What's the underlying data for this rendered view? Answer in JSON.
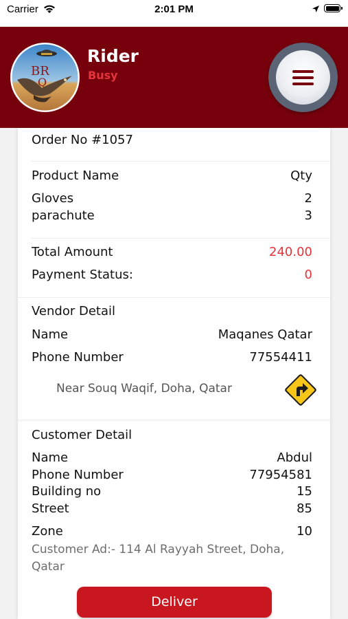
{
  "status_bar": {
    "carrier": "Carrier",
    "time": "2:01 PM"
  },
  "header": {
    "rider_title": "Rider",
    "rider_status": "Busy",
    "logo_text": "BRQ",
    "bg_color": "#77000d",
    "status_color": "#e5343a"
  },
  "order": {
    "number_label": "Order No #1057",
    "product_header": "Product Name",
    "qty_header": "Qty",
    "items": [
      {
        "name": "Gloves",
        "qty": "2"
      },
      {
        "name": "parachute",
        "qty": "3"
      }
    ],
    "total_label": "Total Amount",
    "total_value": "240.00",
    "payment_label": "Payment Status:",
    "payment_value": "0"
  },
  "vendor": {
    "section_title": "Vendor Detail",
    "name_label": "Name",
    "name_value": "Maqanes Qatar",
    "phone_label": "Phone Number",
    "phone_value": "77554411",
    "address": "Near Souq Waqif, Doha, Qatar",
    "nav_icon": "directions-sign-icon"
  },
  "customer": {
    "section_title": "Customer Detail",
    "name_label": "Name",
    "name_value": "Abdul",
    "phone_label": "Phone Number",
    "phone_value": "77954581",
    "building_label": "Building no",
    "building_value": "15",
    "street_label": "Street",
    "street_value": "85",
    "zone_label": "Zone",
    "zone_value": "10",
    "address": "Customer Ad:- 114 Al Rayyah Street, Doha, Qatar"
  },
  "actions": {
    "deliver_label": "Deliver",
    "deliver_color": "#c8171e"
  }
}
